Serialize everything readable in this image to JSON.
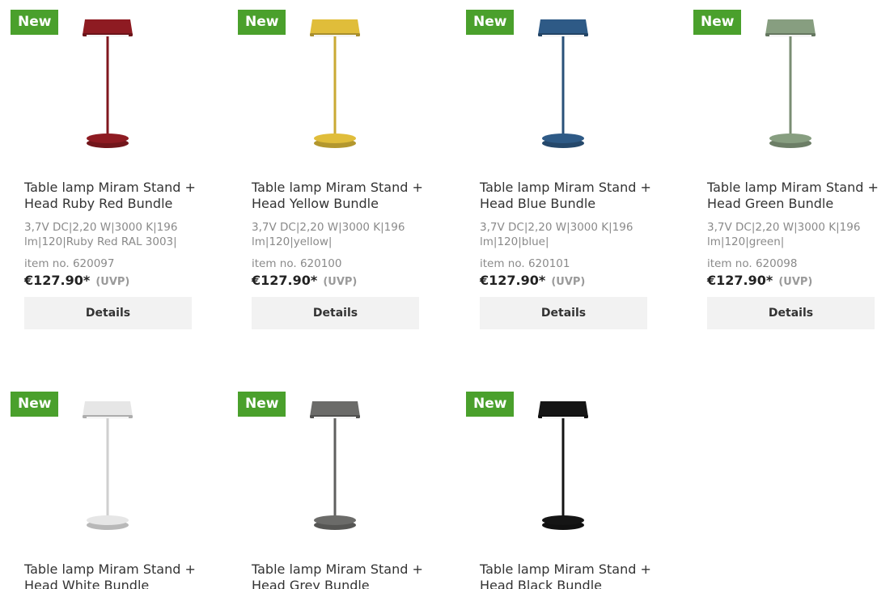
{
  "products": [
    {
      "badge": "New",
      "title": "Table lamp Miram Stand + Head Ruby Red Bundle",
      "specs": "3,7V DC|2,20 W|3000 K|196 lm|120|Ruby Red RAL 3003|",
      "item_no": "item no. 620097",
      "price": "€127.90*",
      "uvp": "(UVP)",
      "details_label": "Details",
      "lamp_color": "#8e1b22",
      "lamp_icon": "ruby-red-table-lamp-image"
    },
    {
      "badge": "New",
      "title": "Table lamp Miram Stand + Head Yellow Bundle",
      "specs": "3,7V DC|2,20 W|3000 K|196 lm|120|yellow|",
      "item_no": "item no. 620100",
      "price": "€127.90*",
      "uvp": "(UVP)",
      "details_label": "Details",
      "lamp_color": "#e0bd3a",
      "lamp_icon": "yellow-table-lamp-image"
    },
    {
      "badge": "New",
      "title": "Table lamp Miram Stand + Head Blue Bundle",
      "specs": "3,7V DC|2,20 W|3000 K|196 lm|120|blue|",
      "item_no": "item no. 620101",
      "price": "€127.90*",
      "uvp": "(UVP)",
      "details_label": "Details",
      "lamp_color": "#2e5a86",
      "lamp_icon": "blue-table-lamp-image"
    },
    {
      "badge": "New",
      "title": "Table lamp Miram Stand + Head Green Bundle",
      "specs": "3,7V DC|2,20 W|3000 K|196 lm|120|green|",
      "item_no": "item no. 620098",
      "price": "€127.90*",
      "uvp": "(UVP)",
      "details_label": "Details",
      "lamp_color": "#879e80",
      "lamp_icon": "green-table-lamp-image"
    },
    {
      "badge": "New",
      "title": "Table lamp Miram Stand + Head White Bundle",
      "lamp_color": "#e6e6e6",
      "lamp_icon": "white-table-lamp-image"
    },
    {
      "badge": "New",
      "title": "Table lamp Miram Stand + Head Grey Bundle",
      "lamp_color": "#6b6b69",
      "lamp_icon": "grey-table-lamp-image"
    },
    {
      "badge": "New",
      "title": "Table lamp Miram Stand + Head Black Bundle",
      "lamp_color": "#151515",
      "lamp_icon": "black-table-lamp-image"
    }
  ],
  "colors": {
    "badge_bg": "#4aa02c",
    "button_bg": "#f2f2f2"
  }
}
